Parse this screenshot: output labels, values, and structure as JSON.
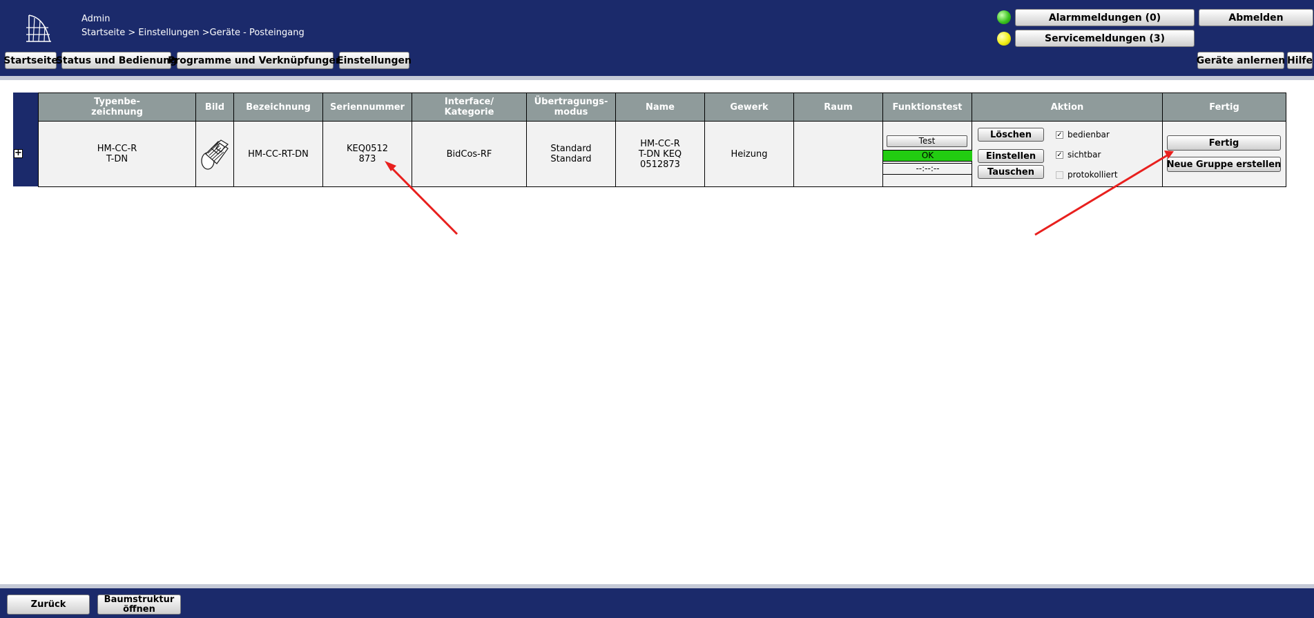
{
  "header": {
    "user": "Admin",
    "breadcrumb": "Startseite > Einstellungen >Geräte - Posteingang",
    "alarm_label": "Alarmmeldungen (0)",
    "service_label": "Servicemeldungen (3)",
    "logout_label": "Abmelden",
    "nav": [
      "Startseite",
      "Status und Bedienung",
      "Programme und Verknüpfungen",
      "Einstellungen"
    ],
    "teach_label": "Geräte anlernen",
    "help_label": "Hilfe",
    "led_colors": {
      "alarm": "#3cc41f",
      "service": "#f2ef14"
    }
  },
  "table": {
    "columns": [
      "Typenbe-\nzeichnung",
      "Bild",
      "Bezeichnung",
      "Seriennummer",
      "Interface/\nKategorie",
      "Übertragungs-\nmodus",
      "Name",
      "Gewerk",
      "Raum",
      "Funktionstest",
      "Aktion",
      "Fertig"
    ],
    "row": {
      "type_name": "HM-CC-R\nT-DN",
      "image_icon": "thermostat-valve-icon",
      "designation": "HM-CC-RT-DN",
      "serial": "KEQ0512\n873",
      "interface": "BidCos-RF",
      "mode": "Standard\nStandard",
      "name": "HM-CC-R\nT-DN KEQ\n0512873",
      "trade": "Heizung",
      "room": "",
      "test_label": "Test",
      "test_status": "OK",
      "test_status_color": "#22cc11",
      "test_time": "--:--:--",
      "delete_label": "Löschen",
      "configure_label": "Einstellen",
      "replace_label": "Tauschen",
      "operable_label": "bedienbar",
      "operable_checked": true,
      "visible_label": "sichtbar",
      "visible_checked": true,
      "logged_label": "protokolliert",
      "logged_checked": false,
      "done_label": "Fertig",
      "new_group_label": "Neue Gruppe erstellen"
    }
  },
  "footer": {
    "back_label": "Zurück",
    "tree_label": "Baumstruktur\nöffnen"
  },
  "colors": {
    "header_bg": "#1b2a6b",
    "table_header_bg": "#8f9b9b",
    "annotation_arrow": "#e8201e"
  }
}
